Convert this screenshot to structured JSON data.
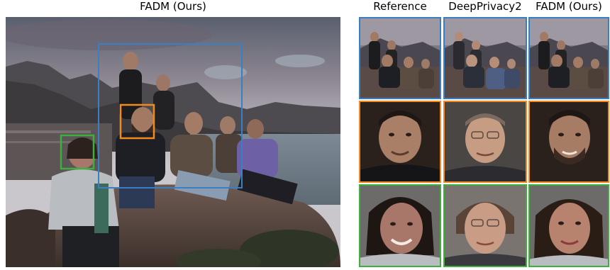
{
  "figure": {
    "main_title": "FADM (Ours)",
    "column_titles": [
      "Reference",
      "DeepPrivacy2",
      "FADM (Ours)"
    ],
    "box_colors": {
      "group": "#3a7fc4",
      "center_face": "#f08a1e",
      "left_face": "#3fae3f"
    }
  }
}
